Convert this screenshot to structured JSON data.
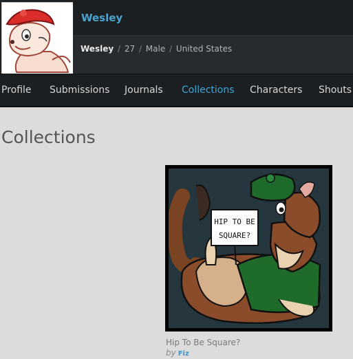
{
  "profile": {
    "username": "Wesley",
    "info_name": "Wesley",
    "age": "27",
    "gender": "Male",
    "location": "United States"
  },
  "nav": {
    "tabs": [
      {
        "label": "Profile",
        "active": false
      },
      {
        "label": "Submissions",
        "active": false
      },
      {
        "label": "Journals",
        "active": false
      },
      {
        "label": "Collections",
        "active": true
      },
      {
        "label": "Characters",
        "active": false
      },
      {
        "label": "Shouts",
        "active": false
      }
    ]
  },
  "page": {
    "title": "Collections"
  },
  "collection": {
    "items": [
      {
        "title": "Hip To Be Square?",
        "by_label": "by",
        "author": "Fiz",
        "sign_text_line1": "HIP TO BE",
        "sign_text_line2": "SQUARE?"
      }
    ]
  },
  "colors": {
    "accent": "#3fa6d6",
    "header_bg": "#1f2326",
    "page_bg": "#dcdcdc"
  }
}
